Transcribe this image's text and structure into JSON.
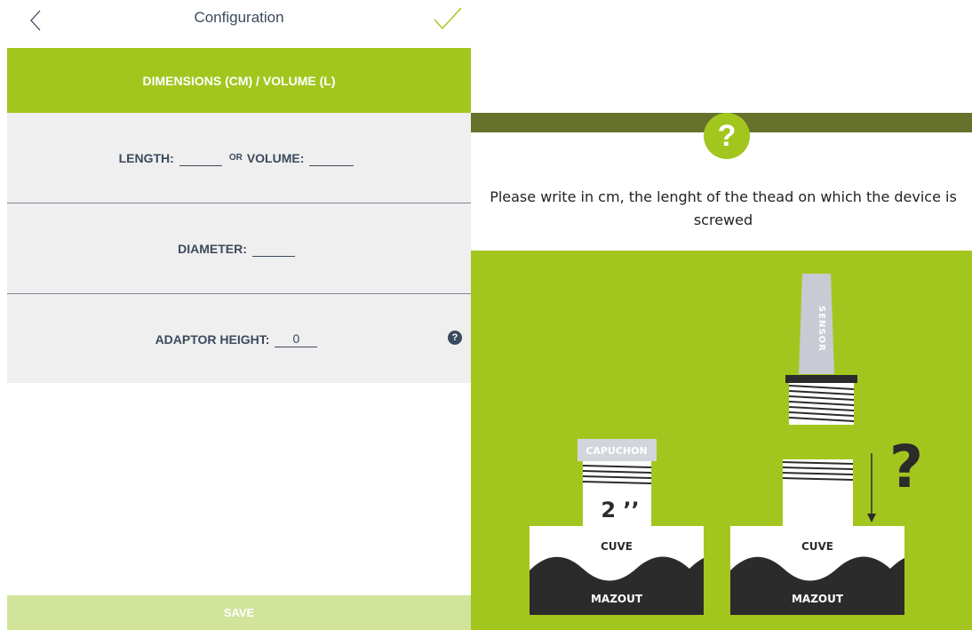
{
  "header": {
    "title": "Configuration"
  },
  "section": {
    "title": "DIMENSIONS (CM) / VOLUME (L)"
  },
  "form": {
    "length_label": "LENGTH:",
    "length_value": "",
    "or_label": "OR",
    "volume_label": "VOLUME:",
    "volume_value": "",
    "diameter_label": "DIAMETER:",
    "diameter_value": "",
    "adaptor_label": "ADAPTOR HEIGHT:",
    "adaptor_value": "0",
    "help_icon": "?"
  },
  "footer": {
    "save_label": "SAVE"
  },
  "help_panel": {
    "badge": "?",
    "text": "Please write in cm, the lenght of the thead on which the device is screwed",
    "illustration": {
      "sensor_label": "SENSOR",
      "capuchon_label": "CAPUCHON",
      "thread_size": "2 ’’",
      "tank_label": "CUVE",
      "fuel_label": "MAZOUT",
      "question_mark": "?"
    }
  },
  "colors": {
    "accent_green": "#a3c61f",
    "light_green": "#d2e39a",
    "olive": "#66712c",
    "text_dark": "#3b4a5c",
    "panel_gray": "#efefef",
    "fuel_dark": "#2b2b2b"
  }
}
